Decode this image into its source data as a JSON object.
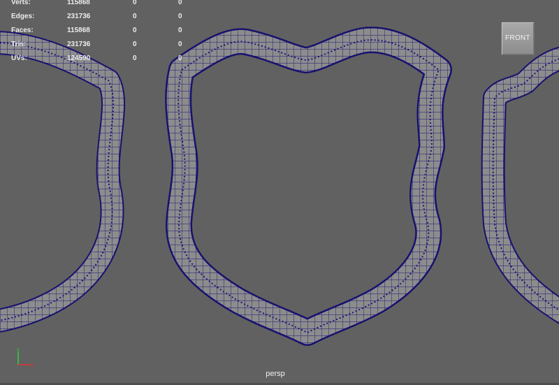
{
  "hud": {
    "rows": [
      {
        "label": "Verts:",
        "v1": "115868",
        "v2": "0",
        "v3": "0"
      },
      {
        "label": "Edges:",
        "v1": "231736",
        "v2": "0",
        "v3": "0"
      },
      {
        "label": "Faces:",
        "v1": "115868",
        "v2": "0",
        "v3": "0"
      },
      {
        "label": "Tris:",
        "v1": "231736",
        "v2": "0",
        "v3": "0"
      },
      {
        "label": "UVs:",
        "v1": "124590",
        "v2": "0",
        "v3": "0"
      }
    ]
  },
  "view_cube": {
    "label": "FRONT"
  },
  "camera": {
    "label": "persp"
  },
  "axis": {
    "y_label": "y",
    "x_label": "x"
  },
  "colors": {
    "viewport_bg": "#616161",
    "mesh_fill": "#8a8a8a",
    "wire": "#17126e",
    "wire_dense": "#1a1478",
    "axis_x": "#e03030",
    "axis_y": "#30d040"
  },
  "icons": {
    "view_cube": "view-cube-icon",
    "axis_gizmo": "axis-gizmo-icon"
  }
}
